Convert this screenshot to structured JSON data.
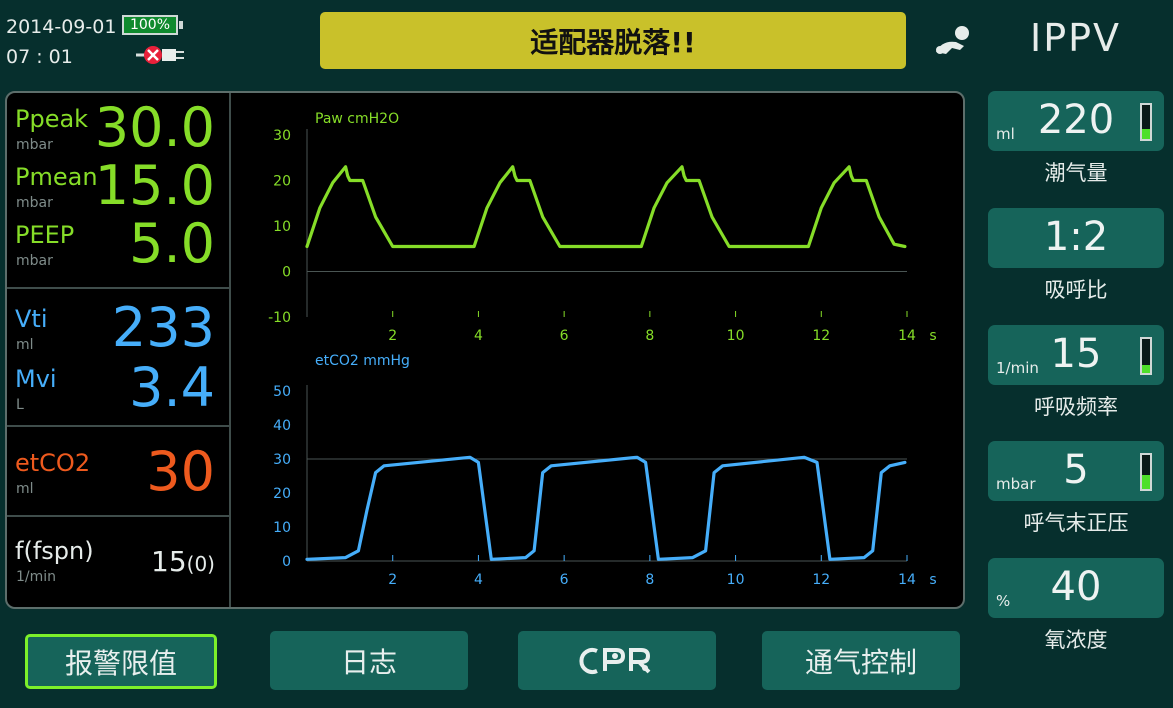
{
  "status": {
    "date": "2014-09-01",
    "time": "07 : 01",
    "battery": "100%",
    "battery_level": 1.0,
    "power_icon": "ac-unplugged-icon",
    "alarm_message": "适配器脱落!!",
    "alarm_color": "#c9c12a",
    "patient_icon": "pediatric-patient-icon",
    "mode": "IPPV"
  },
  "params": {
    "ppeak": {
      "label": "Ppeak",
      "unit": "mbar",
      "value": "30.0"
    },
    "pmean": {
      "label": "Pmean",
      "unit": "mbar",
      "value": "15.0"
    },
    "peep": {
      "label": "PEEP",
      "unit": "mbar",
      "value": "5.0"
    },
    "vti": {
      "label": "Vti",
      "unit": "ml",
      "value": "233"
    },
    "mvi": {
      "label": "Mvi",
      "unit": "L",
      "value": "3.4"
    },
    "etco2": {
      "label": "etCO2",
      "unit": "ml",
      "value": "30"
    },
    "fspn": {
      "label": "f(fspn)",
      "unit": "1/min",
      "value": "15",
      "sub": "(0)"
    }
  },
  "chart_data": [
    {
      "type": "line",
      "title": "Paw cmH2O",
      "color": "#86dd28",
      "xlim": [
        0,
        14
      ],
      "ylim": [
        -10,
        30
      ],
      "yticks": [
        30,
        20,
        10,
        0,
        -10
      ],
      "xticks": [
        2,
        4,
        6,
        8,
        10,
        12,
        14
      ],
      "xunit": "s",
      "series": [
        {
          "x": [
            0,
            0.3,
            0.6,
            0.9,
            0.95,
            1.0,
            1.3,
            1.6,
            2.0,
            3.9,
            4.2,
            4.5,
            4.8,
            4.85,
            4.9,
            5.2,
            5.5,
            5.9,
            7.8,
            8.1,
            8.4,
            8.75,
            8.8,
            8.85,
            9.15,
            9.45,
            9.85,
            11.7,
            12.0,
            12.3,
            12.65,
            12.7,
            12.75,
            13.05,
            13.35,
            13.7,
            13.95
          ],
          "y": [
            5.5,
            14,
            19.5,
            23,
            21,
            20,
            20,
            12,
            5.5,
            5.5,
            14,
            19.5,
            23,
            21,
            20,
            20,
            12,
            5.5,
            5.5,
            14,
            19.5,
            23,
            21,
            20,
            20,
            12,
            5.5,
            5.5,
            14,
            19.5,
            23,
            21,
            20,
            20,
            12,
            6,
            5.5
          ]
        }
      ]
    },
    {
      "type": "line",
      "title": "etCO2 mmHg",
      "color": "#46aefa",
      "xlim": [
        0,
        14
      ],
      "ylim": [
        0,
        50
      ],
      "yticks": [
        50,
        40,
        30,
        20,
        10,
        0
      ],
      "xticks": [
        2,
        4,
        6,
        8,
        10,
        12,
        14
      ],
      "xunit": "s",
      "series": [
        {
          "x": [
            0,
            0.9,
            1.2,
            1.4,
            1.6,
            1.8,
            3.8,
            4.0,
            4.2,
            4.3,
            5.1,
            5.3,
            5.5,
            5.7,
            7.7,
            7.9,
            8.1,
            8.2,
            9.0,
            9.3,
            9.5,
            9.7,
            11.6,
            11.9,
            12.1,
            12.2,
            13.0,
            13.2,
            13.4,
            13.6,
            13.95
          ],
          "y": [
            0.5,
            1,
            3,
            15,
            26,
            28,
            30.5,
            29,
            10,
            0.5,
            1,
            3,
            26,
            28,
            30.5,
            29,
            10,
            0.5,
            1,
            3,
            26,
            28,
            30.5,
            29,
            10,
            0.5,
            1,
            3,
            26,
            28,
            29
          ]
        }
      ]
    }
  ],
  "settings": [
    {
      "unit": "ml",
      "value": "220",
      "label": "潮气量",
      "bar_level": 0.28
    },
    {
      "unit": "",
      "value": "1:2",
      "label": "吸呼比"
    },
    {
      "unit": "1/min",
      "value": "15",
      "label": "呼吸频率",
      "bar_level": 0.25
    },
    {
      "unit": "mbar",
      "value": "5",
      "label": "呼气末正压",
      "bar_level": 0.4
    },
    {
      "unit": "%",
      "value": "40",
      "label": "氧浓度"
    }
  ],
  "buttons": {
    "alarm_limits": "报警限值",
    "log": "日志",
    "cpr": "CPR",
    "vent_control": "通气控制"
  }
}
